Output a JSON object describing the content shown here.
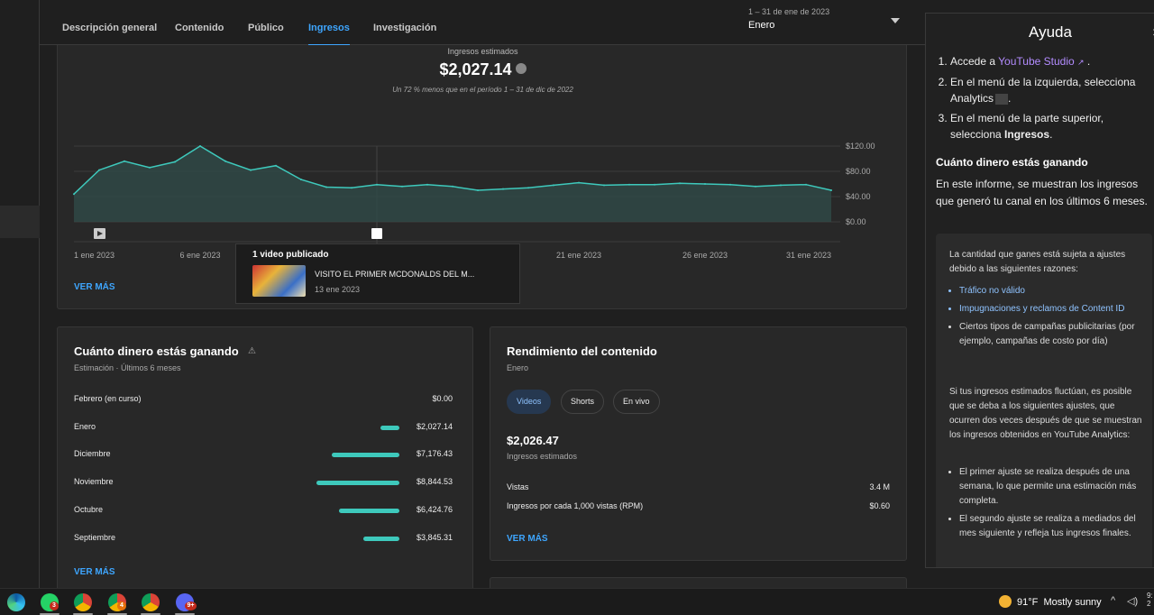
{
  "tabs": [
    "Descripción general",
    "Contenido",
    "Público",
    "Ingresos",
    "Investigación"
  ],
  "active_tab": "Ingresos",
  "period": {
    "range": "1 – 31 de ene de 2023",
    "name": "Enero"
  },
  "revenue": {
    "label": "Ingresos estimados",
    "value": "$2,027.14",
    "comparison": "Un 72 % menos que en el período 1 – 31 de dic de 2022",
    "see_more": "VER MÁS"
  },
  "chart_data": {
    "type": "area",
    "x": [
      "1 ene 2023",
      "2 ene 2023",
      "3 ene 2023",
      "4 ene 2023",
      "5 ene 2023",
      "6 ene 2023",
      "7 ene 2023",
      "8 ene 2023",
      "9 ene 2023",
      "10 ene 2023",
      "11 ene 2023",
      "12 ene 2023",
      "13 ene 2023",
      "14 ene 2023",
      "15 ene 2023",
      "16 ene 2023",
      "17 ene 2023",
      "18 ene 2023",
      "19 ene 2023",
      "20 ene 2023",
      "21 ene 2023",
      "22 ene 2023",
      "23 ene 2023",
      "24 ene 2023",
      "25 ene 2023",
      "26 ene 2023",
      "27 ene 2023",
      "28 ene 2023",
      "29 ene 2023",
      "30 ene 2023",
      "31 ene 2023"
    ],
    "values": [
      44,
      82,
      96,
      86,
      95,
      120,
      96,
      82,
      89,
      67,
      55,
      54,
      59,
      56,
      59,
      56,
      50,
      52,
      54,
      58,
      62,
      58,
      59,
      59,
      61,
      60,
      59,
      56,
      58,
      59,
      50
    ],
    "tick_labels": [
      "1 ene 2023",
      "6 ene 2023",
      "21 ene 2023",
      "26 ene 2023",
      "31 ene 2023"
    ],
    "y_ticks": [
      "$120.00",
      "$80.00",
      "$40.00",
      "$0.00"
    ],
    "ylim": [
      0,
      120
    ],
    "marker_date": "13 ene 2023",
    "color": "#3ec9bc"
  },
  "tooltip": {
    "title": "1 video publicado",
    "video_title": "VISITO EL PRIMER MCDONALDS DEL M...",
    "video_date": "13 ene 2023"
  },
  "earnings": {
    "title": "Cuánto dinero estás ganando",
    "subtitle": "Estimación · Últimos 6 meses",
    "warn_icon": "⚠",
    "see_more": "VER MÁS",
    "rows": [
      {
        "month": "Febrero (en curso)",
        "value": "$0.00",
        "amount": 0
      },
      {
        "month": "Enero",
        "value": "$2,027.14",
        "amount": 2027.14
      },
      {
        "month": "Diciembre",
        "value": "$7,176.43",
        "amount": 7176.43
      },
      {
        "month": "Noviembre",
        "value": "$8,844.53",
        "amount": 8844.53
      },
      {
        "month": "Octubre",
        "value": "$6,424.76",
        "amount": 6424.76
      },
      {
        "month": "Septiembre",
        "value": "$3,845.31",
        "amount": 3845.31
      }
    ]
  },
  "performance": {
    "title": "Rendimiento del contenido",
    "subtitle": "Enero",
    "chips": [
      "Videos",
      "Shorts",
      "En vivo"
    ],
    "active_chip": "Videos",
    "big_value": "$2,026.47",
    "big_label": "Ingresos estimados",
    "stats": [
      {
        "label": "Vistas",
        "value": "3.4 M"
      },
      {
        "label": "Ingresos por cada 1,000 vistas (RPM)",
        "value": "$0.60"
      }
    ],
    "see_more": "VER MÁS"
  },
  "help": {
    "title": "Ayuda",
    "close": "×",
    "steps": [
      {
        "pre": "Accede a ",
        "link": "YouTube Studio",
        "post": " ."
      },
      {
        "pre": "En el menú de la izquierda, selecciona Analytics",
        "link": "",
        "post": "."
      },
      {
        "pre": "En el menú de la parte superior, selecciona ",
        "bold": "Ingresos",
        "post": "."
      }
    ],
    "section_title": "Cuánto dinero estás ganando",
    "section_text": "En este informe, se muestran los ingresos que generó tu canal en los últimos 6 meses.",
    "box_intro": "La cantidad que ganes está sujeta a ajustes debido a las siguientes razones:",
    "box_reasons": [
      "Tráfico no válido",
      "Impugnaciones y reclamos de Content ID",
      "Ciertos tipos de campañas publicitarias (por ejemplo, campañas de costo por día)"
    ],
    "box_middle": "Si tus ingresos estimados fluctúan, es posible que se deba a los siguientes ajustes, que ocurren dos veces después de que se muestran los ingresos obtenidos en YouTube Analytics:",
    "box_adjustments": [
      "El primer ajuste se realiza después de una semana, lo que permite una estimación más completa.",
      "El segundo ajuste se realiza a mediados del mes siguiente y refleja tus ingresos finales."
    ]
  },
  "taskbar": {
    "weather_temp": "91°F",
    "weather_text": "Mostly sunny",
    "badges": [
      "3",
      "4",
      "9+"
    ],
    "clock_fragment": "9:",
    "date_fragment": "2"
  }
}
